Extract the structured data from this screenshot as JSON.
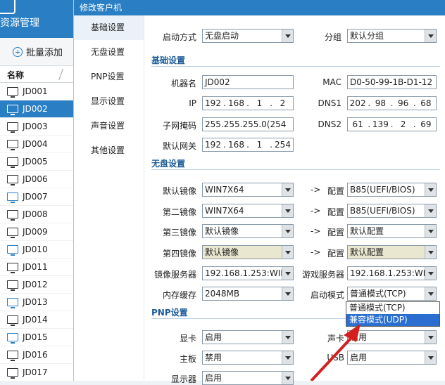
{
  "app": {
    "title": "资源管理",
    "batch_add_label": "批量添加",
    "list_header": "名称",
    "machines": [
      "JD001",
      "JD002",
      "JD003",
      "JD004",
      "JD005",
      "JD006",
      "JD007",
      "JD008",
      "JD009",
      "JD010",
      "JD011",
      "JD012",
      "JD013",
      "JD014",
      "JD015",
      "JD016",
      "JD017"
    ],
    "selected_machine": "JD002"
  },
  "dialog": {
    "title": "修改客户机",
    "nav": [
      "基础设置",
      "无盘设置",
      "PNP设置",
      "显示设置",
      "声音设置",
      "其他设置"
    ],
    "boot_mode_label": "启动方式",
    "boot_mode_value": "无盘启动",
    "group_label": "分组",
    "group_value": "默认分组",
    "basic_section": "基础设置",
    "machine_name_label": "机器名",
    "machine_name_value": "JD002",
    "mac_label": "MAC",
    "mac_value": "D0-50-99-1B-D1-12",
    "ip_label": "IP",
    "ip_value": [
      "192",
      "168",
      "1",
      "2"
    ],
    "dns1_label": "DNS1",
    "dns1_value": [
      "202",
      "98",
      "96",
      "68"
    ],
    "subnet_label": "子网掩码",
    "subnet_value": "255.255.255.0(254",
    "dns2_label": "DNS2",
    "dns2_value": [
      "61",
      "139",
      "2",
      "69"
    ],
    "gateway_label": "默认网关",
    "gateway_value": [
      "192",
      "168",
      "1",
      "254"
    ],
    "diskless_section": "无盘设置",
    "arrow_text": "->",
    "config_label": "配置",
    "image1_label": "默认镜像",
    "image1_value": "WIN7X64",
    "config1_value": "B85(UEFI/BIOS)",
    "image2_label": "第二镜像",
    "image2_value": "WIN7X64",
    "config2_value": "B85(UEFI/BIOS)",
    "image3_label": "第三镜像",
    "image3_value": "默认镜像",
    "config3_value": "默认配置",
    "image4_label": "第四镜像",
    "image4_value": "默认镜像",
    "config4_value": "默认配置",
    "image_server_label": "镜像服务器",
    "image_server_value": "192.168.1.253:WIN",
    "game_server_label": "游戏服务器",
    "game_server_value": "192.168.1.253:WIN",
    "mem_cache_label": "内存缓存",
    "mem_cache_value": "2048MB",
    "start_mode_label": "启动模式",
    "start_mode_value": "普通模式(TCP)",
    "start_mode_options": [
      "普通模式(TCP)",
      "兼容模式(UDP)"
    ],
    "pnp_section": "PNP设置",
    "gpu_label": "显卡",
    "gpu_value": "启用",
    "sound_label": "声卡",
    "sound_value": "启用",
    "board_label": "主板",
    "board_value": "禁用",
    "usb_label": "USB",
    "usb_value": "启用",
    "display_label": "显示器",
    "display_value": "启用"
  },
  "colors": {
    "accent": "#2a7fc4",
    "annotation": "#d41f1f"
  }
}
